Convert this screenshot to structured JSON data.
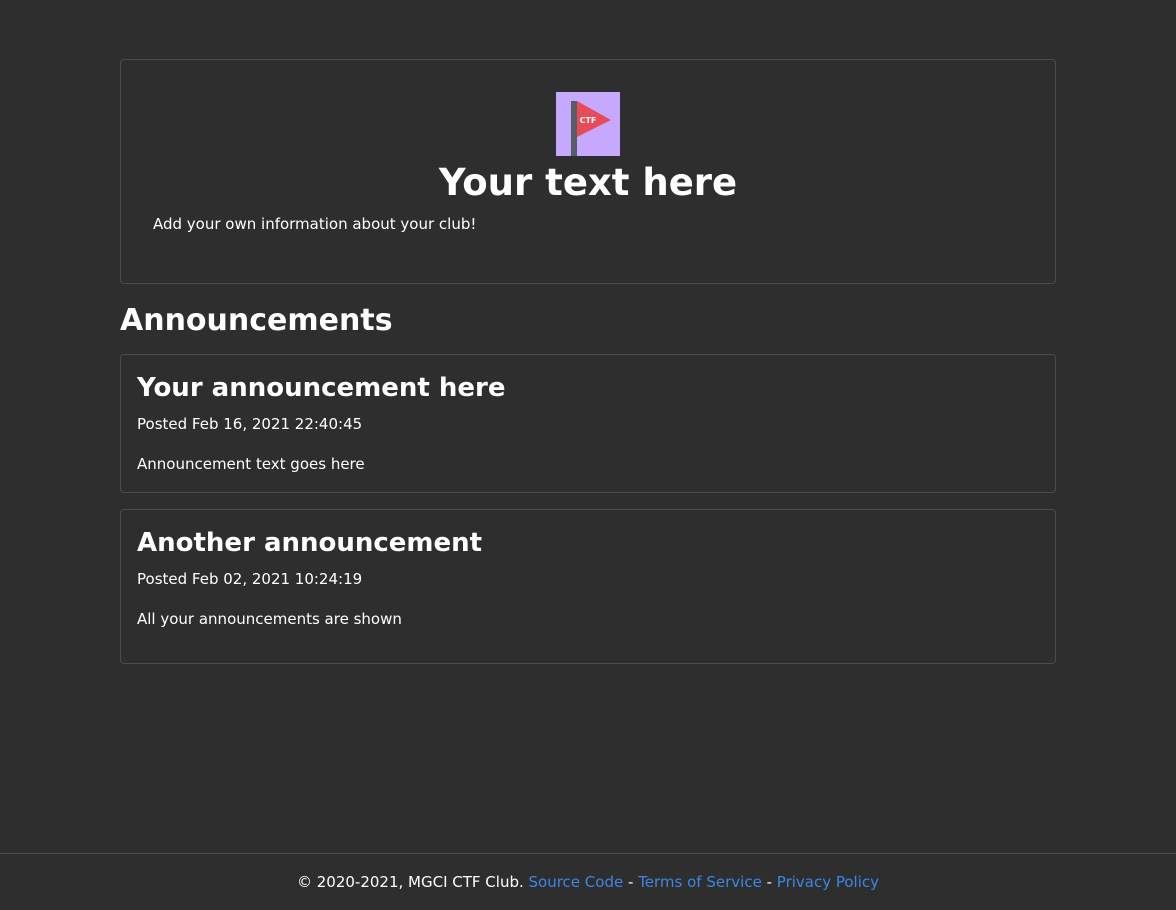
{
  "intro": {
    "logo_text": "CTF",
    "title": "Your text here",
    "description": "Add your own information about your club!"
  },
  "announcements": {
    "heading": "Announcements",
    "items": [
      {
        "title": "Your announcement here",
        "posted": "Posted Feb 16, 2021 22:40:45",
        "body": "Announcement text goes here"
      },
      {
        "title": "Another announcement",
        "posted": "Posted Feb 02, 2021 10:24:19",
        "body": "All your announcements are shown"
      }
    ]
  },
  "footer": {
    "copyright": "© 2020-2021, MGCI CTF Club.",
    "source_code": "Source Code",
    "separator": "-",
    "terms": "Terms of Service",
    "privacy": "Privacy Policy"
  },
  "colors": {
    "background": "#2e2e2e",
    "border": "#4c4c4c",
    "link": "#3d86e6",
    "logo_background": "#c6a9ff",
    "flag": "#e84b57",
    "pole": "#555f66"
  }
}
